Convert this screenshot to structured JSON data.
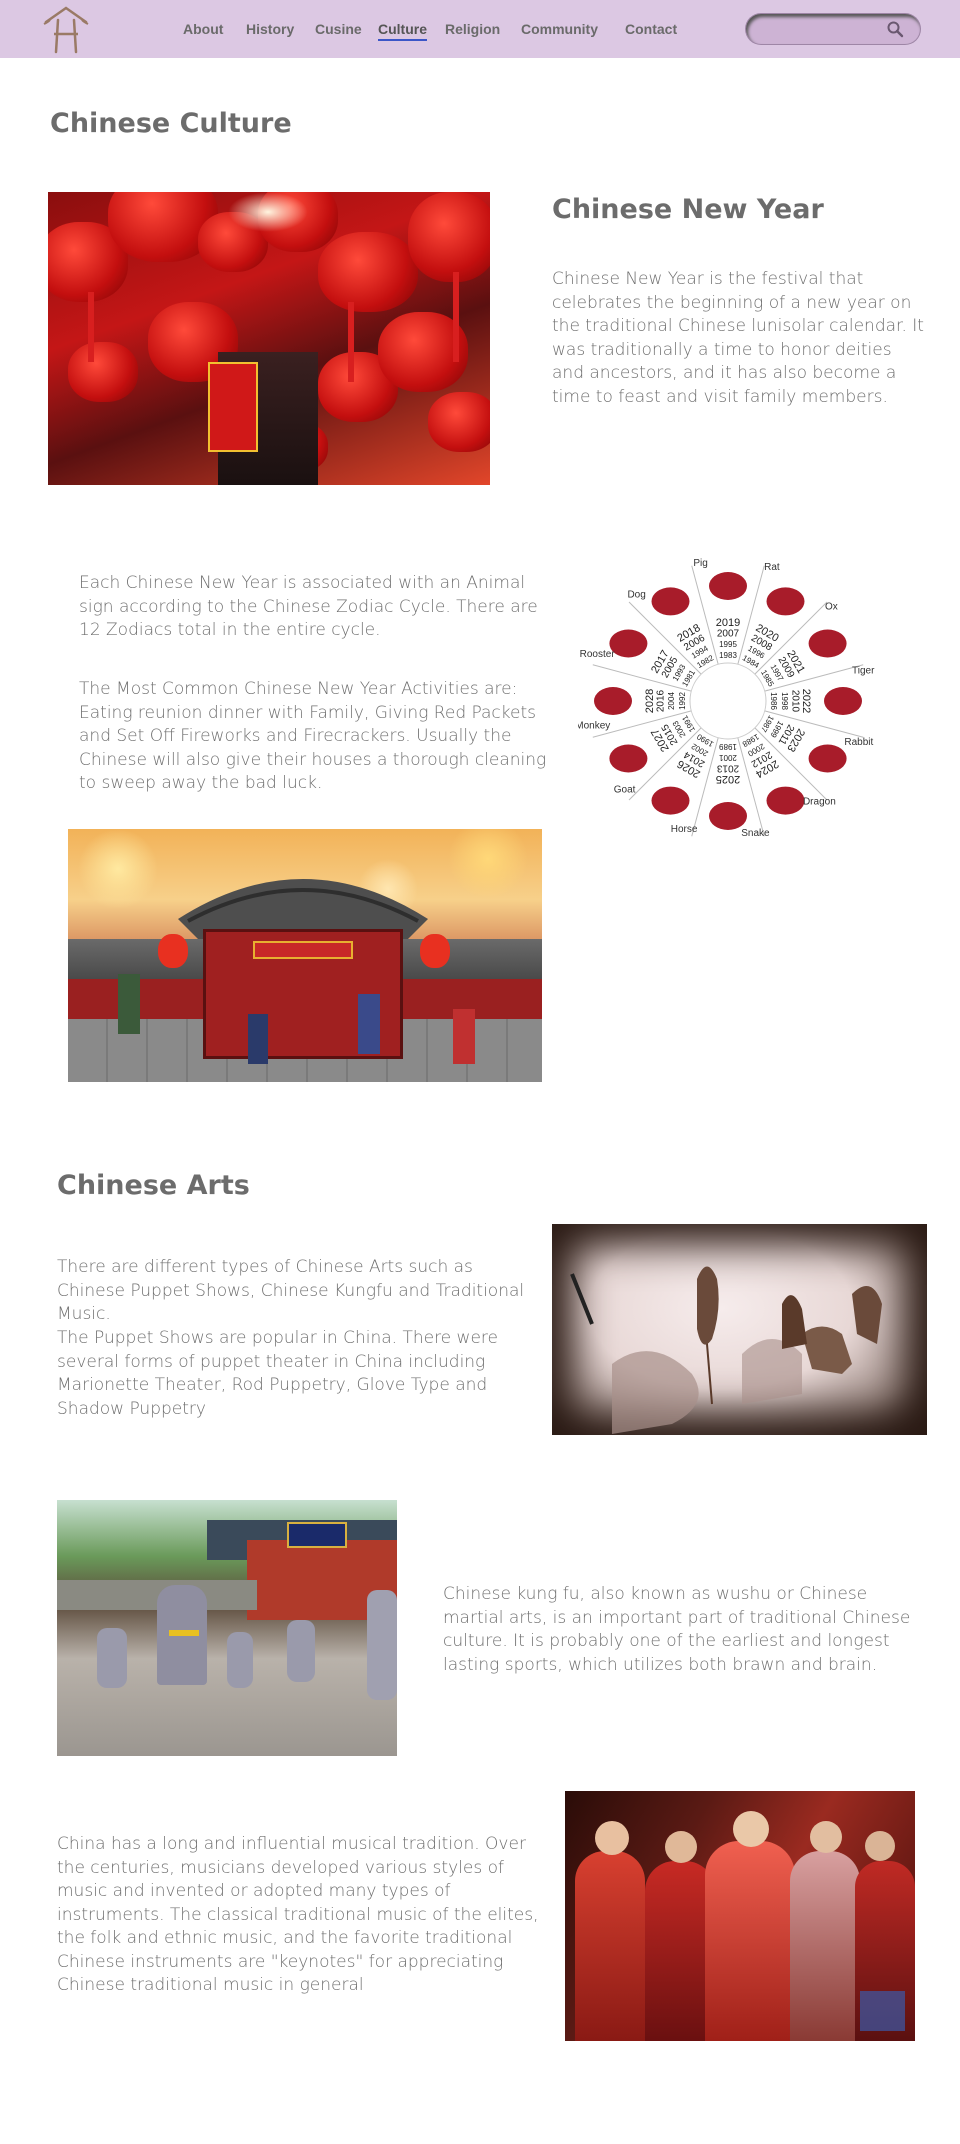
{
  "nav": {
    "items": [
      "About",
      "History",
      "Cusine",
      "Culture",
      "Religion",
      "Community",
      "Contact"
    ],
    "active": "Culture",
    "accent_color": "#3b56c8",
    "background_color": "#dcc8e3"
  },
  "search": {
    "placeholder": "",
    "icon": "search-icon"
  },
  "logo": {
    "icon": "pagoda-logo-icon"
  },
  "page_title": "Chinese Culture",
  "new_year": {
    "heading": "Chinese New Year",
    "intro": "Chinese New Year is the festival that celebrates the beginning of a new year on the traditional Chinese lunisolar calendar. It was traditionally a time to honor deities and ancestors, and it has also become a time to feast and visit family members.",
    "zodiac_paragraph": "Each Chinese New Year is associated with an Animal sign according to the Chinese Zodiac Cycle. There are 12 Zodiacs total in the entire cycle.",
    "activities_paragraph": "The Most Common Chinese New Year Activities are: Eating reunion dinner with Family, Giving Red Packets and Set Off Fireworks and Firecrackers. Usually the Chinese will also give their houses a thorough cleaning to sweep away the bad luck."
  },
  "zodiac_wheel": {
    "animals": [
      "Pig",
      "Rat",
      "Ox",
      "Tiger",
      "Rabbit",
      "Dragon",
      "Snake",
      "Horse",
      "Goat",
      "Monkey",
      "Rooster",
      "Dog"
    ],
    "years": [
      [
        "2019",
        "2007",
        "1995",
        "1983"
      ],
      [
        "2020",
        "2008",
        "1996",
        "1984"
      ],
      [
        "2021",
        "2009",
        "1997",
        "1985"
      ],
      [
        "2022",
        "2010",
        "1998",
        "1986"
      ],
      [
        "2023",
        "2011",
        "1999",
        "1987"
      ],
      [
        "2024",
        "2012",
        "2000",
        "1988"
      ],
      [
        "2025",
        "2013",
        "2001",
        "1989"
      ],
      [
        "2026",
        "2014",
        "2002",
        "1990"
      ],
      [
        "2027",
        "2015",
        "2003",
        "1991"
      ],
      [
        "2028",
        "2016",
        "2004",
        "1992"
      ],
      [
        "2017",
        "2005",
        "1993",
        "1981"
      ],
      [
        "2018",
        "2006",
        "1994",
        "1982"
      ]
    ],
    "color": "#a81c2a"
  },
  "arts": {
    "heading": "Chinese Arts",
    "intro": "There are different types of Chinese Arts such as Chinese Puppet Shows, Chinese Kungfu and Traditional Music.",
    "puppet": "The Puppet Shows are popular in China. There were several forms of puppet theater in China including Marionette Theater, Rod Puppetry, Glove Type and Shadow Puppetry",
    "kungfu": "Chinese kung fu, also known as wushu or Chinese martial arts, is an important part of traditional Chinese culture. It is probably one of the earliest and longest lasting sports, which utilizes both brawn and brain.",
    "music": "China has a long and influential musical tradition. Over the centuries, musicians developed various styles of music and invented or adopted many types of instruments. The classical traditional music of the elites, the folk and ethnic music, and the favorite traditional Chinese instruments are \"keynotes\" for appreciating Chinese traditional music in general"
  },
  "images": {
    "lanterns": "red-lanterns-photo",
    "zodiac": "zodiac-wheel-image",
    "festival": "new-year-festival-illustration",
    "puppet": "shadow-puppet-photo",
    "kungfu": "kungfu-practice-photo",
    "music": "traditional-music-photo"
  }
}
